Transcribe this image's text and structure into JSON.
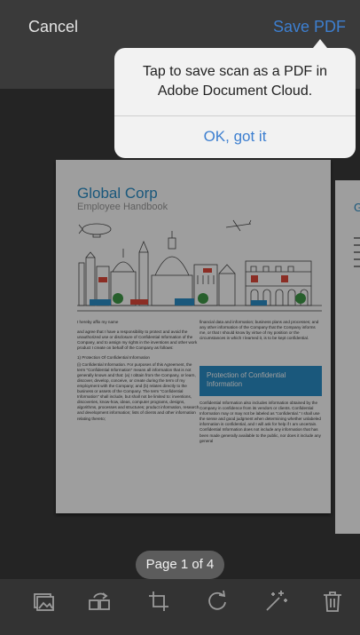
{
  "header": {
    "cancel_label": "Cancel",
    "save_label": "Save PDF"
  },
  "tooltip": {
    "message": "Tap to save scan as a PDF in Adobe Document Cloud.",
    "confirm_label": "OK, got it"
  },
  "document": {
    "title": "Global Corp",
    "subtitle": "Employee Handbook",
    "left_column": [
      "I hereby affix my name",
      "and agree that I have a responsibility to protect and avoid the unauthorized use or disclosure of Confidential Information of the Company, and to assign my rights in the inventions and other work product I create on behalf of the Company as follows:",
      "1) Protection Of Confidential Information",
      "(i) Confidential Information. For purposes of this Agreement, the term \"Confidential Information\" means all information that is not generally known and that: (a) I obtain from the Company, or learn, discover, develop, conceive, or create during the term of my employment with the Company; and (b) relates directly to the business or assets of the Company. The term \"Confidential Information\" shall include, but shall not be limited to: inventions, discoveries, know-how, ideas, computer programs, designs, algorithms, processes and structures; product information, research and development information; lists of clients and other information relating thereto;"
    ],
    "right_column_top": "financial data and information; business plans and processes; and any other information of the Company that the Company informs me, or that I should know by virtue of my position or the circumstances in which I learned it, is to be kept confidential.",
    "callout_title": "Protection of Confidential Information",
    "right_column_bottom": "Confidential Information also includes information obtained by the Company in confidence from its vendors or clients. Confidential Information may or may not be labeled as \"confidential.\" I shall use the sense and good judgment when determining whether unlabeled information is confidential, and I will ask for help if I am uncertain. Confidential Information does not include any information that has been made generally available to the public, nor does it include any general"
  },
  "next_page": {
    "title_fragment": "GE"
  },
  "pager": {
    "label": "Page 1 of 4"
  },
  "toolbar": {
    "icons": [
      "gallery-icon",
      "rescan-icon",
      "crop-icon",
      "rotate-icon",
      "enhance-icon",
      "trash-icon"
    ]
  },
  "colors": {
    "accent": "#3d7fd0",
    "document_blue": "#2a8fc8",
    "tooltip_bg": "#f2f2f2"
  }
}
